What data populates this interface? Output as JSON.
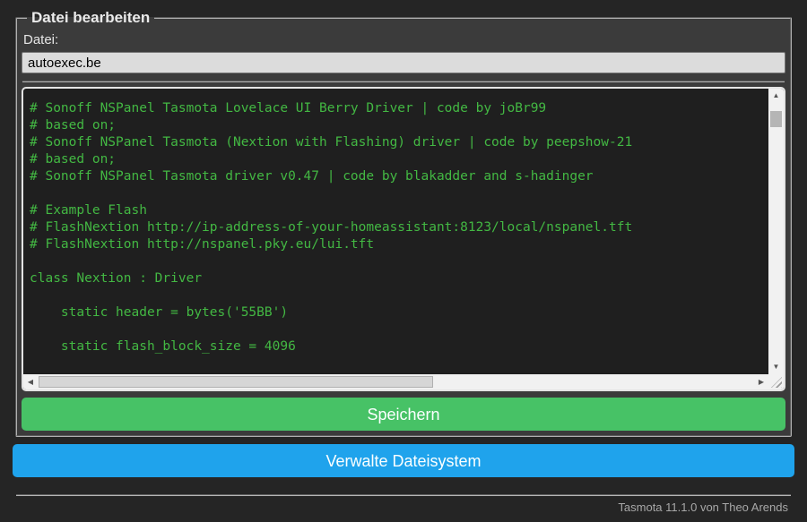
{
  "editor_card": {
    "legend": "Datei bearbeiten",
    "file_field": {
      "label": "Datei:",
      "value": "autoexec.be"
    },
    "code_editor": {
      "content": "# Sonoff NSPanel Tasmota Lovelace UI Berry Driver | code by joBr99\n# based on;\n# Sonoff NSPanel Tasmota (Nextion with Flashing) driver | code by peepshow-21\n# based on;\n# Sonoff NSPanel Tasmota driver v0.47 | code by blakadder and s-hadinger\n\n# Example Flash\n# FlashNextion http://ip-address-of-your-homeassistant:8123/local/nspanel.tft\n# FlashNextion http://nspanel.pky.eu/lui.tft\n\nclass Nextion : Driver\n\n    static header = bytes('55BB')\n\n    static flash_block_size = 4096\n",
      "text_color": "#43b843",
      "background": "#1f1f1f"
    },
    "save_button": {
      "label": "Speichern",
      "color": "#47c266"
    }
  },
  "manage_fs_button": {
    "label": "Verwalte Dateisystem",
    "color": "#1fa3ec"
  },
  "footer": {
    "text": "Tasmota 11.1.0 von Theo Arends"
  },
  "colors": {
    "page_background": "#252525",
    "form_background": "#3b3b3b",
    "accent_green": "#47c266",
    "accent_blue": "#1fa3ec",
    "code_green": "#43b843"
  },
  "icons": {
    "scroll_up": "▲",
    "scroll_down": "▼",
    "scroll_left": "◀",
    "scroll_right": "▶"
  }
}
